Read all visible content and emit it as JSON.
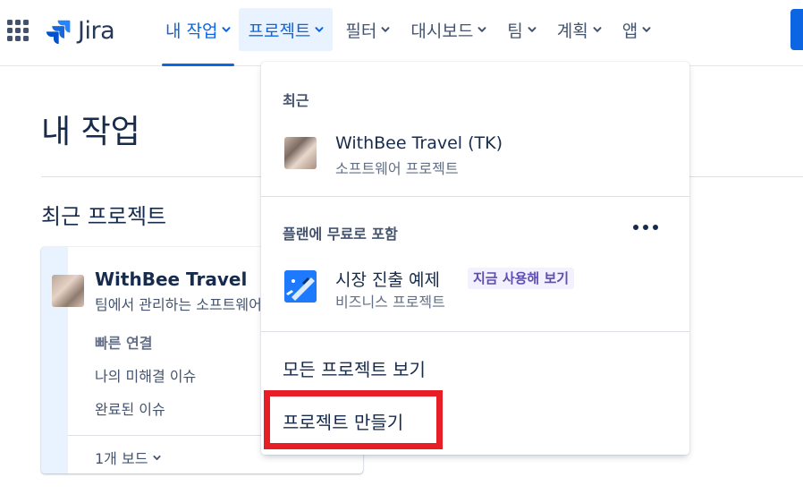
{
  "brand": {
    "name": "Jira"
  },
  "nav": {
    "items": [
      {
        "label": "내 작업"
      },
      {
        "label": "프로젝트"
      },
      {
        "label": "필터"
      },
      {
        "label": "대시보드"
      },
      {
        "label": "팀"
      },
      {
        "label": "계획"
      },
      {
        "label": "앱"
      }
    ]
  },
  "page": {
    "title": "내 작업",
    "section_title": "최근 프로젝트",
    "card": {
      "name": "WithBee Travel",
      "subtitle": "팀에서 관리하는 소프트웨어 프로젝트",
      "quick_links_label": "빠른 연결",
      "links": [
        "나의 미해결 이슈",
        "완료된 이슈"
      ],
      "boards_label": "1개 보드"
    }
  },
  "dropdown": {
    "recent_heading": "최근",
    "recent_item": {
      "title": "WithBee Travel (TK)",
      "subtitle": "소프트웨어 프로젝트"
    },
    "plan_heading": "플랜에 무료로 포함",
    "plan_item": {
      "title": "시장 진출 예제",
      "badge": "지금 사용해 보기",
      "subtitle": "비즈니스 프로젝트"
    },
    "view_all": "모든 프로젝트 보기",
    "create": "프로젝트 만들기"
  },
  "colors": {
    "accent": "#0c66e4",
    "highlight": "#e81e26",
    "badge_bg": "#f3f0ff",
    "badge_text": "#5e4db2"
  },
  "icons": {
    "app_switcher": "grid-icon",
    "logo": "jira-logo-icon",
    "chevron": "chevron-down-icon",
    "more": "more-dots-icon",
    "plan": "rocket-icon"
  }
}
